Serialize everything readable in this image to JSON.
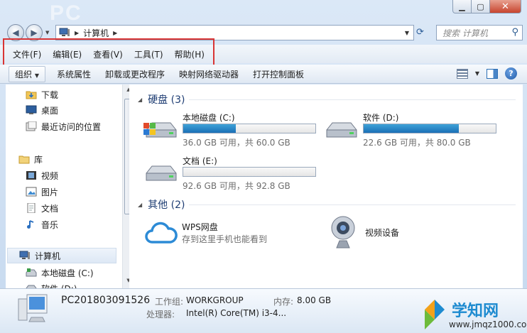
{
  "window": {
    "bg_logo": "PC",
    "controls": {
      "minimize": "▁",
      "maximize": "▢",
      "close": "✕"
    }
  },
  "nav": {
    "path_root": "计算机",
    "search_placeholder": "搜索 计算机"
  },
  "menu": [
    "文件(F)",
    "编辑(E)",
    "查看(V)",
    "工具(T)",
    "帮助(H)"
  ],
  "commands": {
    "organize": "组织",
    "items": [
      "系统属性",
      "卸载或更改程序",
      "映射网络驱动器",
      "打开控制面板"
    ]
  },
  "sidebar": {
    "items": [
      {
        "label": "下载",
        "icon": "downloads-folder-icon"
      },
      {
        "label": "桌面",
        "icon": "desktop-icon"
      },
      {
        "label": "最近访问的位置",
        "icon": "recent-places-icon"
      },
      {
        "label": "库",
        "icon": "library-icon"
      },
      {
        "label": "视频",
        "icon": "video-library-icon"
      },
      {
        "label": "图片",
        "icon": "pictures-library-icon"
      },
      {
        "label": "文档",
        "icon": "documents-library-icon"
      },
      {
        "label": "音乐",
        "icon": "music-library-icon"
      },
      {
        "label": "计算机",
        "icon": "computer-icon"
      },
      {
        "label": "本地磁盘 (C:)",
        "icon": "drive-c-icon"
      },
      {
        "label": "软件 (D:)",
        "icon": "drive-d-icon"
      }
    ]
  },
  "groups": {
    "drives_header": "硬盘 (3)",
    "other_header": "其他 (2)"
  },
  "drives": [
    {
      "name": "本地磁盘 (C:)",
      "free": "36.0 GB 可用，共 60.0 GB",
      "used_fraction": 0.4
    },
    {
      "name": "软件 (D:)",
      "free": "22.6 GB 可用，共 80.0 GB",
      "used_fraction": 0.72
    },
    {
      "name": "文档 (E:)",
      "free": "92.6 GB 可用，共 92.8 GB",
      "used_fraction": 0.002
    }
  ],
  "other": [
    {
      "title": "WPS网盘",
      "subtitle": "存到这里手机也能看到"
    },
    {
      "title": "视频设备",
      "subtitle": ""
    }
  ],
  "details": {
    "pc_name": "PC201803091526",
    "workgroup_label": "工作组:",
    "workgroup_value": "WORKGROUP",
    "memory_label": "内存:",
    "memory_value": "8.00 GB",
    "cpu_label": "处理器:",
    "cpu_value": "Intel(R) Core(TM) i3-4..."
  },
  "watermark": {
    "title": "学知网",
    "url": "www.jmqz1000.com"
  },
  "colors": {
    "accent": "#1e3d73",
    "bar_fill": "#2a86c8",
    "highlight": "#d93434"
  }
}
